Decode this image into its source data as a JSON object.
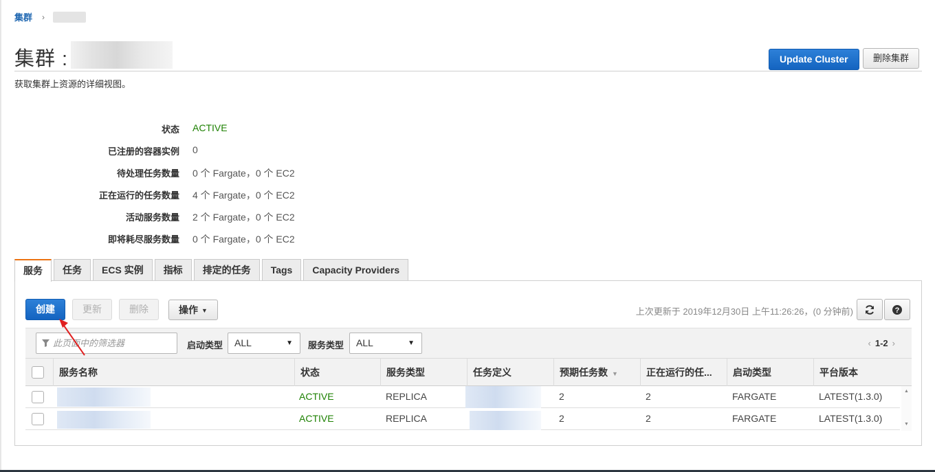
{
  "breadcrumb": {
    "root": "集群",
    "separator": "›"
  },
  "header": {
    "title": "集群 :",
    "update_button": "Update Cluster",
    "delete_button": "删除集群",
    "subtitle": "获取集群上资源的详细视图。"
  },
  "details": [
    {
      "label": "状态",
      "value": "ACTIVE"
    },
    {
      "label": "已注册的容器实例",
      "value": "0"
    },
    {
      "label": "待处理任务数量",
      "value": "0 个 Fargate，0 个 EC2"
    },
    {
      "label": "正在运行的任务数量",
      "value": "4 个 Fargate，0 个 EC2"
    },
    {
      "label": "活动服务数量",
      "value": "2 个 Fargate，0 个 EC2"
    },
    {
      "label": "即将耗尽服务数量",
      "value": "0 个 Fargate，0 个 EC2"
    }
  ],
  "tabs": [
    "服务",
    "任务",
    "ECS 实例",
    "指标",
    "排定的任务",
    "Tags",
    "Capacity Providers"
  ],
  "toolbar": {
    "create": "创建",
    "update": "更新",
    "delete": "删除",
    "actions": "操作",
    "last_updated": "上次更新于 2019年12月30日 上午11:26:26，(0 分钟前)",
    "refresh_icon": "refresh-icon",
    "help_icon": "help-icon"
  },
  "filters": {
    "search_placeholder": "此页面中的筛选器",
    "launch_type_label": "启动类型",
    "launch_type_value": "ALL",
    "service_type_label": "服务类型",
    "service_type_value": "ALL",
    "pagination": "1-2"
  },
  "table": {
    "columns": [
      "服务名称",
      "状态",
      "服务类型",
      "任务定义",
      "预期任务数",
      "正在运行的任...",
      "启动类型",
      "平台版本"
    ],
    "rows": [
      {
        "status": "ACTIVE",
        "service_type": "REPLICA",
        "desired": "2",
        "running": "2",
        "launch_type": "FARGATE",
        "platform": "LATEST(1.3.0)"
      },
      {
        "status": "ACTIVE",
        "service_type": "REPLICA",
        "desired": "2",
        "running": "2",
        "launch_type": "FARGATE",
        "platform": "LATEST(1.3.0)"
      }
    ]
  },
  "colors": {
    "accent": "#1464c0",
    "active": "#1d8102",
    "tab_highlight": "#ec7211",
    "annotation_arrow": "#e02020"
  }
}
